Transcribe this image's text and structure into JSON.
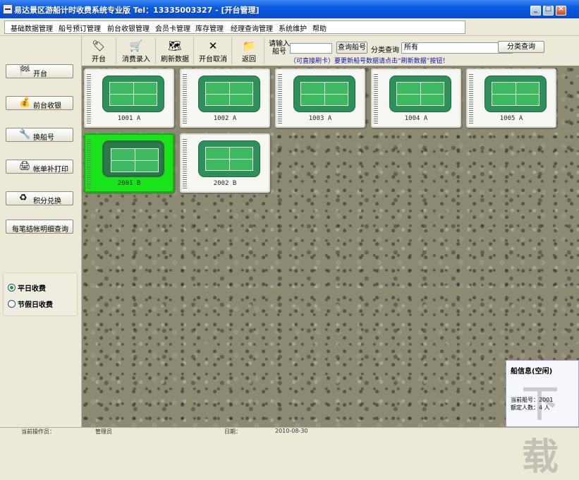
{
  "window": {
    "title": "易达景区游船计时收费系统专业版 Tel：13335003327 - [开台管理]",
    "controls": [
      "_",
      "□",
      "×"
    ]
  },
  "menu": [
    "基础数据管理",
    "船号预订管理",
    "前台收银管理",
    "会员卡管理",
    "库存管理",
    "经理查询管理",
    "系统维护",
    "帮助"
  ],
  "sidebar": {
    "buttons": [
      {
        "label": "开台",
        "icon": "open-table-icon",
        "glyph": "🏁"
      },
      {
        "label": "前台收银",
        "icon": "cashier-icon",
        "glyph": "💰"
      },
      {
        "label": "换船号",
        "icon": "swap-icon",
        "glyph": "🔧"
      },
      {
        "label": "帐单补打印",
        "icon": "printer-icon",
        "glyph": "🖨"
      },
      {
        "label": "积分兑换",
        "icon": "points-icon",
        "glyph": "♻"
      },
      {
        "label": "每笔结帐明细查询",
        "icon": "",
        "glyph": ""
      }
    ],
    "radios": [
      {
        "label": "平日收费",
        "checked": true
      },
      {
        "label": "节假日收费",
        "checked": false
      }
    ]
  },
  "toolbar": {
    "buttons": [
      {
        "label": "开台",
        "icon": "open-icon",
        "glyph": "🏷"
      },
      {
        "label": "消费录入",
        "icon": "consume-icon",
        "glyph": "🛒"
      },
      {
        "label": "刷新数据",
        "icon": "refresh-icon",
        "glyph": "🗺"
      },
      {
        "label": "开台取消",
        "icon": "cancel-icon",
        "glyph": "✕"
      },
      {
        "label": "返回",
        "icon": "return-icon",
        "glyph": "📁"
      }
    ],
    "prompt": "请输入船号",
    "boat_input_value": "",
    "query_button": "查询船号",
    "category_label": "分类查询",
    "category_selected": "所有",
    "category_query_button": "分类查询",
    "hint": "（可直接刷卡）要更新船号数据请点击“刷新数据”按钮！"
  },
  "boats": [
    {
      "label": "1001  A",
      "active": false
    },
    {
      "label": "1002  A",
      "active": false
    },
    {
      "label": "1003  A",
      "active": false
    },
    {
      "label": "1004  A",
      "active": false
    },
    {
      "label": "1005  A",
      "active": false
    },
    {
      "label": "2001  B",
      "active": true
    },
    {
      "label": "2002  B",
      "active": false
    }
  ],
  "info_panel": {
    "title": "船信息(空闲)",
    "current_boat": "当前船号：2001",
    "rated_people": "额定人数：4 人"
  },
  "status_bar": {
    "operator": "当前操作员：",
    "admin": "管理员",
    "date_label": "日期：",
    "date": "2010-08-30"
  },
  "watermark": "下载"
}
